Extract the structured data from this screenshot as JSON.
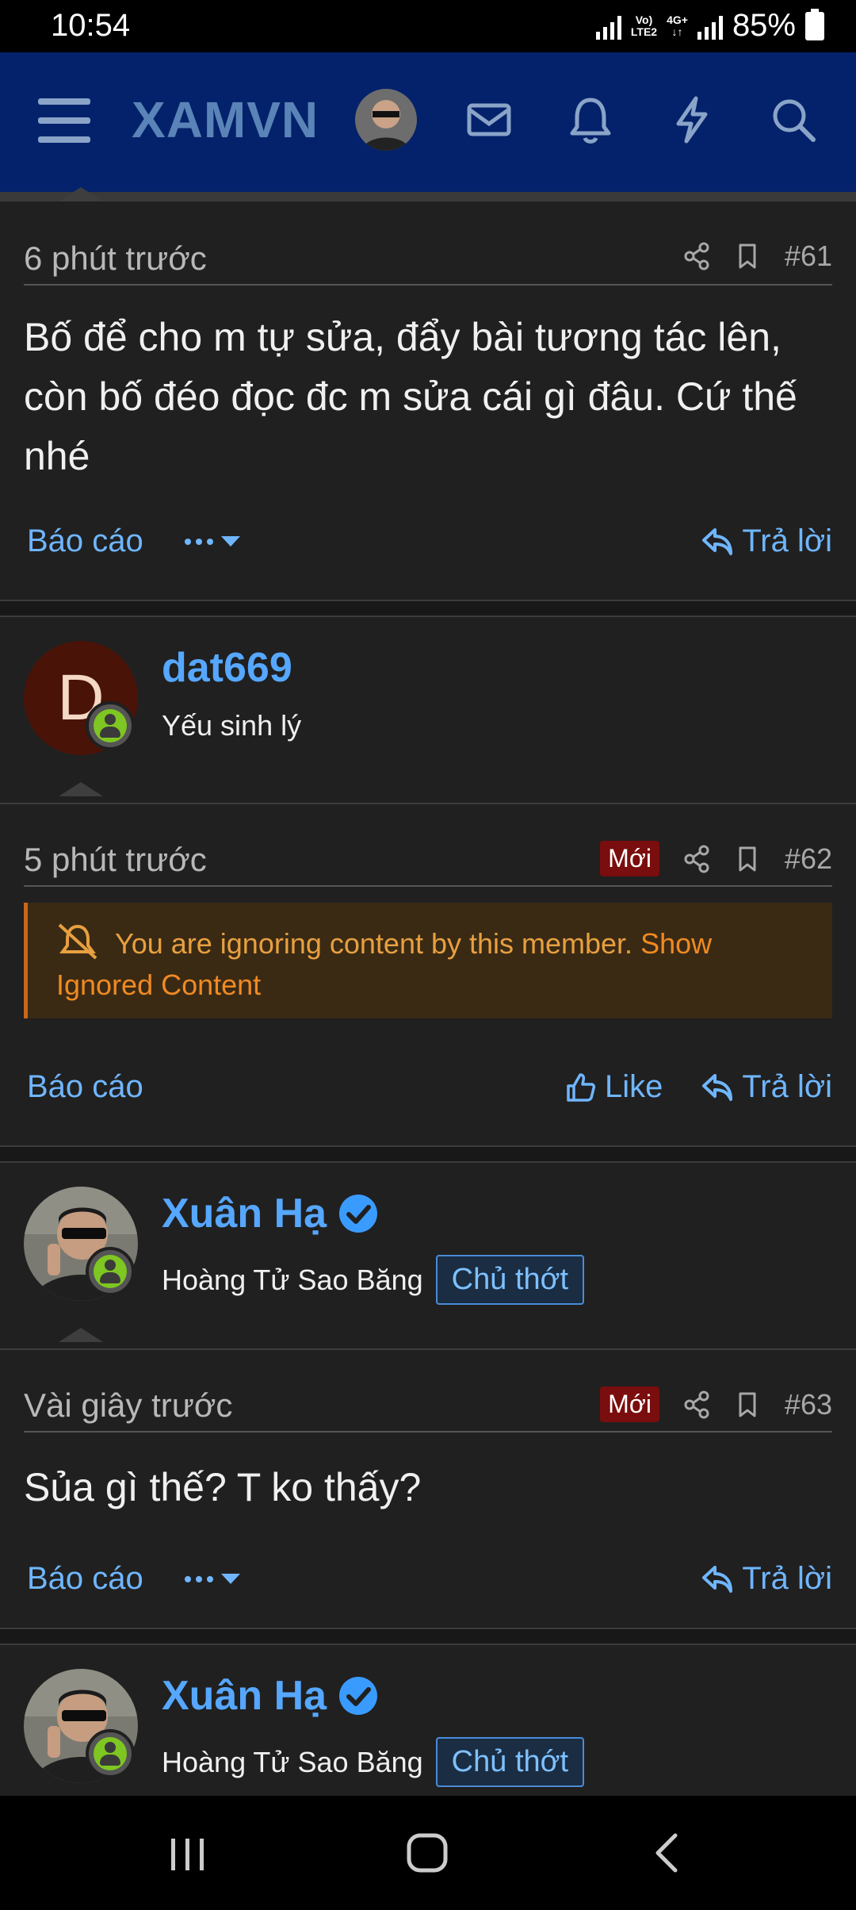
{
  "status": {
    "time": "10:54",
    "net_top": "Vo)",
    "net_bottom": "LTE2",
    "net2": "4G+",
    "battery": "85%"
  },
  "header": {
    "logo": "XAMVN"
  },
  "posts": [
    {
      "time": "6 phút trước",
      "number": "#61",
      "content": "Bố để cho m tự sửa, đẩy bài tương tác lên, còn bố đéo đọc đc m sửa cái gì đâu. Cứ thế nhé",
      "report": "Báo cáo",
      "reply": "Trả lời"
    },
    {
      "author": "dat669",
      "avatar_letter": "D",
      "user_title": "Yếu sinh lý",
      "time": "5 phút trước",
      "new_badge": "Mới",
      "number": "#62",
      "ignored_text": "You are ignoring content by this member.",
      "ignored_link": "Show Ignored Content",
      "report": "Báo cáo",
      "like": "Like",
      "reply": "Trả lời"
    },
    {
      "author": "Xuân Hạ",
      "user_title": "Hoàng Tử Sao Băng",
      "role": "Chủ thớt",
      "time": "Vài giây trước",
      "new_badge": "Mới",
      "number": "#63",
      "content": "Sủa gì thế? T ko thấy?",
      "report": "Báo cáo",
      "reply": "Trả lời"
    },
    {
      "author": "Xuân Hạ",
      "user_title": "Hoàng Tử Sao Băng",
      "role": "Chủ thớt"
    }
  ],
  "colors": {
    "header_bg": "#04226b",
    "link": "#6fb6ff",
    "username": "#56a7ff",
    "new_badge": "#7a0d0d",
    "ignored_bg": "#3a2a14"
  }
}
